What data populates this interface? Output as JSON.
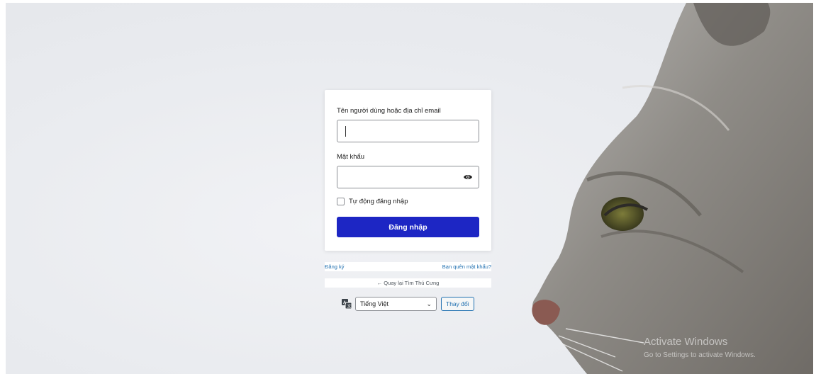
{
  "login_form": {
    "username_label": "Tên người dùng hoặc địa chỉ email",
    "username_value": "",
    "password_label": "Mật khẩu",
    "password_value": "",
    "remember_label": "Tự động đăng nhập",
    "remember_checked": false,
    "submit_label": "Đăng nhập",
    "submit_color": "#1d26c4"
  },
  "links": {
    "register": "Đăng ký",
    "lost_password": "Bạn quên mật khẩu?",
    "back_to_site": "← Quay lại Tìm Thú Cưng"
  },
  "language": {
    "icon": "translate-icon",
    "selected": "Tiếng Việt",
    "change_label": "Thay đổi"
  },
  "background": {
    "image": "cat-photo",
    "watermark_line1": "Activate Windows",
    "watermark_line2": "Go to Settings to activate Windows."
  }
}
